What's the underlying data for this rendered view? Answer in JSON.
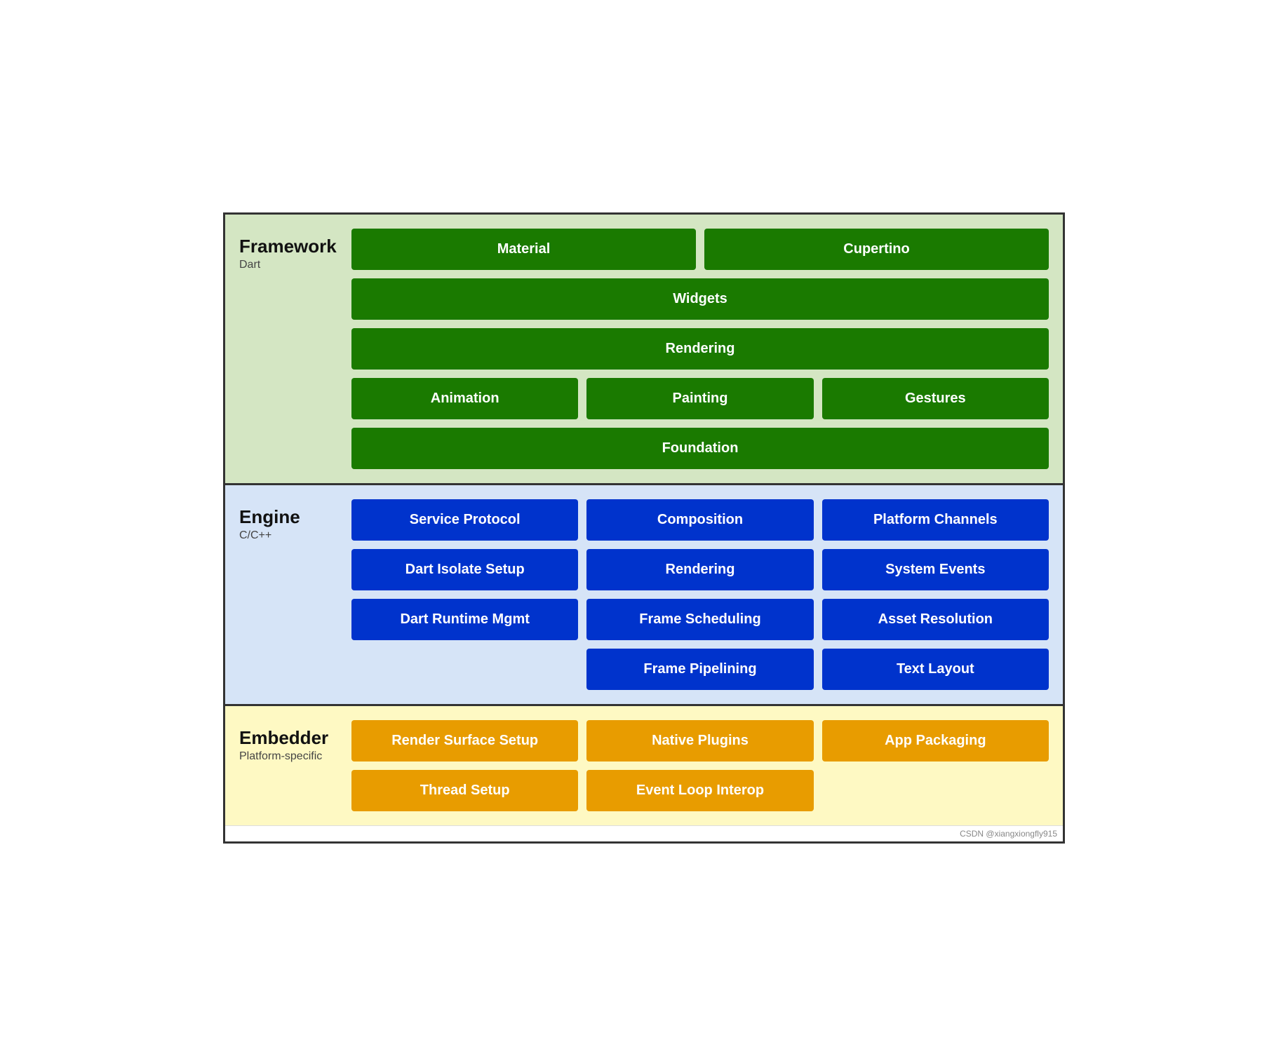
{
  "framework": {
    "title": "Framework",
    "subtitle": "Dart",
    "rows": [
      [
        {
          "label": "Material",
          "span": 1
        },
        {
          "label": "Cupertino",
          "span": 1
        }
      ],
      [
        {
          "label": "Widgets",
          "span": 2
        }
      ],
      [
        {
          "label": "Rendering",
          "span": 2
        }
      ],
      [
        {
          "label": "Animation",
          "span": 1
        },
        {
          "label": "Painting",
          "span": 1
        },
        {
          "label": "Gestures",
          "span": 1
        }
      ],
      [
        {
          "label": "Foundation",
          "span": 3
        }
      ]
    ]
  },
  "engine": {
    "title": "Engine",
    "subtitle": "C/C++",
    "rows": [
      [
        {
          "label": "Service Protocol"
        },
        {
          "label": "Composition"
        },
        {
          "label": "Platform Channels"
        }
      ],
      [
        {
          "label": "Dart Isolate Setup"
        },
        {
          "label": "Rendering"
        },
        {
          "label": "System Events"
        }
      ],
      [
        {
          "label": "Dart Runtime Mgmt"
        },
        {
          "label": "Frame Scheduling"
        },
        {
          "label": "Asset Resolution"
        }
      ],
      [
        {
          "label": "",
          "empty": true
        },
        {
          "label": "Frame Pipelining"
        },
        {
          "label": "Text Layout"
        }
      ]
    ]
  },
  "embedder": {
    "title": "Embedder",
    "subtitle": "Platform-specific",
    "rows": [
      [
        {
          "label": "Render Surface Setup"
        },
        {
          "label": "Native Plugins"
        },
        {
          "label": "App Packaging"
        }
      ],
      [
        {
          "label": "Thread Setup"
        },
        {
          "label": "Event Loop Interop"
        },
        {
          "label": "",
          "empty": true
        }
      ]
    ]
  },
  "watermark": "CSDN @xiangxiongfly915"
}
